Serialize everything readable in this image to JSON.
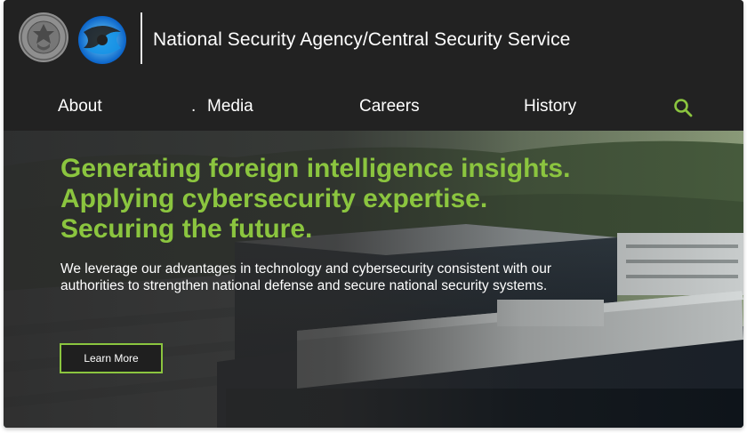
{
  "header": {
    "title": "National Security Agency/Central Security Service",
    "seal_icon": "nsa-seal-icon",
    "logo_icon": "css-logo-icon",
    "divider_color": "#e6e6e6"
  },
  "nav": {
    "items": [
      {
        "label": "About"
      },
      {
        "label": "."
      },
      {
        "label": "Media"
      },
      {
        "label": "Careers"
      },
      {
        "label": "History"
      }
    ],
    "search_icon": "search-icon",
    "accent": "#8bc53f"
  },
  "hero": {
    "headline": [
      "Generating foreign intelligence insights.",
      "Applying cybersecurity expertise.",
      "Securing the future."
    ],
    "subtext": "We leverage our advantages in technology and cybersecurity consistent with our authorities to strengthen national defense and secure national security systems.",
    "button_label": "Learn More",
    "headline_color": "#8bc53f"
  },
  "colors": {
    "background": "#222222",
    "text": "#ffffff",
    "accent": "#8bc53f"
  }
}
